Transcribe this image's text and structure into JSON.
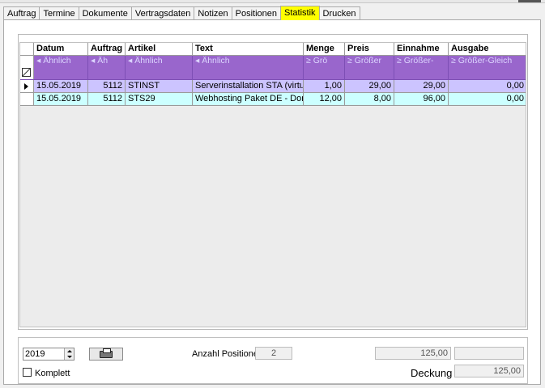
{
  "tabs": [
    {
      "label": "Auftrag",
      "active": false
    },
    {
      "label": "Termine",
      "active": false
    },
    {
      "label": "Dokumente",
      "active": false
    },
    {
      "label": "Vertragsdaten",
      "active": false
    },
    {
      "label": "Notizen",
      "active": false
    },
    {
      "label": "Positionen",
      "active": false
    },
    {
      "label": "Statistik",
      "active": true
    },
    {
      "label": "Drucken",
      "active": false
    }
  ],
  "grid": {
    "columns": [
      "Datum",
      "Auftrag",
      "Artikel",
      "Text",
      "Menge",
      "Preis",
      "Einnahme",
      "Ausgabe"
    ],
    "filters": [
      "Ähnlich",
      "Äh",
      "Ähnlich",
      "Ähnlich",
      "Grö",
      "Größer",
      "Größer-",
      "Größer-Gleich"
    ],
    "rows": [
      [
        "15.05.2019",
        "5112",
        "STINST",
        "Serverinstallation STA (virtuell",
        "1,00",
        "29,00",
        "29,00",
        "0,00"
      ],
      [
        "15.05.2019",
        "5112",
        "STS29",
        "Webhosting Paket DE - Domai",
        "12,00",
        "8,00",
        "96,00",
        "0,00"
      ]
    ]
  },
  "footer": {
    "year": "2019",
    "komplett_label": "Komplett",
    "anzahl_label": "Anzahl Positionen",
    "anzahl_value": "2",
    "total_value": "125,00",
    "extra_value": "",
    "deckung_label": "Deckung",
    "deckung_value": "125,00"
  },
  "icons": {
    "print": "printer-icon",
    "filter": "filter-clear-icon",
    "row_pointer": "row-pointer-icon",
    "spin": "spin-arrows-icon"
  },
  "colors": {
    "active_tab": "#ffff00",
    "filter_row": "#9966cc",
    "row_selected": "#ccc4ff",
    "row_alt": "#ccffff"
  }
}
